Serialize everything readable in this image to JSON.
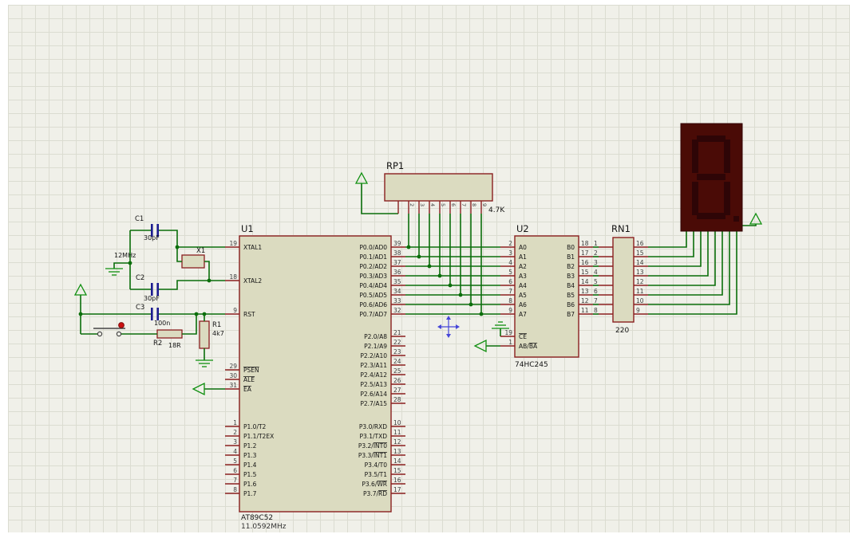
{
  "colors": {
    "page_bg": "#ffffff",
    "grid_bg": "#f0f0e9",
    "grid_line": "#dbdcd1",
    "wire": "#0b6e0b",
    "pin": "#8a1f1f",
    "chip_fill": "#dbdbc0",
    "chip_border": "#8a1f1f",
    "text": "#141414",
    "pin_number": "#3d3d3d",
    "terminal": "#0f8f0f",
    "cap_plate": "#1c1c8f",
    "display_body": "#4a0b06",
    "display_segment": "#2e0506",
    "display_border": "#330505",
    "button_dot": "#cc1111",
    "crosshair": "#4646d8"
  },
  "u1": {
    "ref": "U1",
    "part": "AT89C52",
    "clock": "11.0592MHz",
    "left_pins": [
      {
        "num": "19",
        "name": "XTAL1"
      },
      {
        "num": "18",
        "name": "XTAL2"
      },
      {
        "num": "9",
        "name": "RST"
      },
      {
        "num": "29",
        "name": "PSEN",
        "ov": "PSEN"
      },
      {
        "num": "30",
        "name": "ALE",
        "ov": "ALE"
      },
      {
        "num": "31",
        "name": "EA",
        "ov": "EA"
      },
      {
        "num": "1",
        "name": "P1.0/T2"
      },
      {
        "num": "2",
        "name": "P1.1/T2EX"
      },
      {
        "num": "3",
        "name": "P1.2"
      },
      {
        "num": "4",
        "name": "P1.3"
      },
      {
        "num": "5",
        "name": "P1.4"
      },
      {
        "num": "6",
        "name": "P1.5"
      },
      {
        "num": "7",
        "name": "P1.6"
      },
      {
        "num": "8",
        "name": "P1.7"
      }
    ],
    "right_pins": [
      {
        "num": "39",
        "name": "P0.0/AD0"
      },
      {
        "num": "38",
        "name": "P0.1/AD1"
      },
      {
        "num": "37",
        "name": "P0.2/AD2"
      },
      {
        "num": "36",
        "name": "P0.3/AD3"
      },
      {
        "num": "35",
        "name": "P0.4/AD4"
      },
      {
        "num": "34",
        "name": "P0.5/AD5"
      },
      {
        "num": "33",
        "name": "P0.6/AD6"
      },
      {
        "num": "32",
        "name": "P0.7/AD7"
      },
      {
        "num": "21",
        "name": "P2.0/A8"
      },
      {
        "num": "22",
        "name": "P2.1/A9"
      },
      {
        "num": "23",
        "name": "P2.2/A10"
      },
      {
        "num": "24",
        "name": "P2.3/A11"
      },
      {
        "num": "25",
        "name": "P2.4/A12"
      },
      {
        "num": "26",
        "name": "P2.5/A13"
      },
      {
        "num": "27",
        "name": "P2.6/A14"
      },
      {
        "num": "28",
        "name": "P2.7/A15"
      },
      {
        "num": "10",
        "name": "P3.0/RXD"
      },
      {
        "num": "11",
        "name": "P3.1/TXD"
      },
      {
        "num": "12",
        "name": "P3.2/INT0",
        "ov": "INT0"
      },
      {
        "num": "13",
        "name": "P3.3/INT1",
        "ov": "INT1"
      },
      {
        "num": "14",
        "name": "P3.4/T0"
      },
      {
        "num": "15",
        "name": "P3.5/T1"
      },
      {
        "num": "16",
        "name": "P3.6/WR",
        "ov": "WR"
      },
      {
        "num": "17",
        "name": "P3.7/RD",
        "ov": "RD"
      }
    ]
  },
  "u2": {
    "ref": "U2",
    "part": "74HC245",
    "left_pins": [
      {
        "num": "2",
        "name": "A0"
      },
      {
        "num": "3",
        "name": "A1"
      },
      {
        "num": "4",
        "name": "A2"
      },
      {
        "num": "5",
        "name": "A3"
      },
      {
        "num": "6",
        "name": "A4"
      },
      {
        "num": "7",
        "name": "A5"
      },
      {
        "num": "8",
        "name": "A6"
      },
      {
        "num": "9",
        "name": "A7"
      }
    ],
    "ctrl_pins": [
      {
        "num": "19",
        "name": "CE",
        "ov": "CE"
      },
      {
        "num": "1",
        "name": "AB/BA",
        "ov": "BA"
      }
    ],
    "right_pins": [
      {
        "num": "18",
        "name": "B0"
      },
      {
        "num": "17",
        "name": "B1"
      },
      {
        "num": "16",
        "name": "B2"
      },
      {
        "num": "15",
        "name": "B3"
      },
      {
        "num": "14",
        "name": "B4"
      },
      {
        "num": "13",
        "name": "B5"
      },
      {
        "num": "12",
        "name": "B6"
      },
      {
        "num": "11",
        "name": "B7"
      }
    ]
  },
  "rp1": {
    "ref": "RP1",
    "value": "4.7K",
    "pin_labels": [
      "2",
      "3",
      "4",
      "5",
      "6",
      "7",
      "8",
      "9"
    ]
  },
  "rn1": {
    "ref": "RN1",
    "value": "220",
    "left_pin_numbers": [
      "1",
      "2",
      "3",
      "4",
      "5",
      "6",
      "7",
      "8"
    ],
    "right_pin_numbers": [
      "16",
      "15",
      "14",
      "13",
      "12",
      "11",
      "10",
      "9"
    ]
  },
  "parts": {
    "c1": {
      "ref": "C1",
      "value": "30pF"
    },
    "c2": {
      "ref": "C2",
      "value": "30pF"
    },
    "c3": {
      "ref": "C3",
      "value": "100n"
    },
    "x1": {
      "ref": "X1",
      "value": "12MHz"
    },
    "r1": {
      "ref": "R1",
      "value": "4k7"
    },
    "r2": {
      "ref": "R2",
      "value": "18R"
    }
  }
}
